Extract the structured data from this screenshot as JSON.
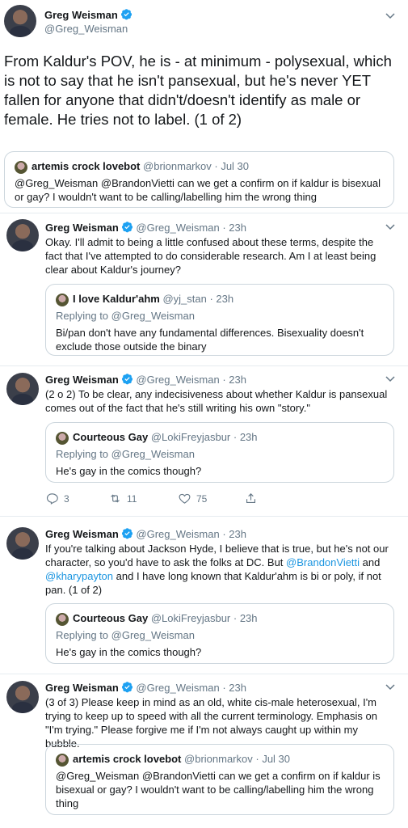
{
  "main": {
    "author": {
      "name": "Greg Weisman",
      "handle": "@Greg_Weisman"
    },
    "text": "From Kaldur's POV, he is - at minimum - polysexual, which is not to say that he isn't pansexual, but he's never YET  fallen for anyone that didn't/doesn't identify as male or female.  He tries not to label.  (1 of 2)",
    "quote": {
      "name": "artemis crock lovebot",
      "handle": "@brionmarkov",
      "date": "· Jul 30",
      "text": "@Greg_Weisman @BrandonVietti can we get a confirm on if kaldur is bisexual or gay? I wouldn't want to be calling/labelling him the wrong thing"
    }
  },
  "reply1": {
    "name": "Greg Weisman",
    "handle": "@Greg_Weisman",
    "time": "· 23h",
    "text": "Okay.  I'll admit to being a little confused about these terms, despite the fact that I've attempted to do considerable research.  Am I at least being clear about Kaldur's journey?",
    "quote": {
      "name": "I love Kaldur'ahm",
      "handle": "@yj_stan",
      "time": "· 23h",
      "replying": "Replying to @Greg_Weisman",
      "text": "Bi/pan don't have any fundamental differences. Bisexuality doesn't exclude those outside the binary"
    }
  },
  "reply2": {
    "name": "Greg Weisman",
    "handle": "@Greg_Weisman",
    "time": "· 23h",
    "text": "(2 o 2) To be clear, any indecisiveness about whether Kaldur is pansexual comes out of the fact that he's still writing his own \"story.\"",
    "quote": {
      "name": "Courteous Gay",
      "handle": "@LokiFreyjasbur",
      "time": "· 23h",
      "replying": "Replying to @Greg_Weisman",
      "text": "He's gay in the comics though?"
    },
    "actions": {
      "replies": "3",
      "retweets": "11",
      "likes": "75"
    }
  },
  "reply3": {
    "name": "Greg Weisman",
    "handle": "@Greg_Weisman",
    "time": "· 23h",
    "text_a": "If you're talking about Jackson Hyde, I believe that is true, but he's not our character, so you'd have to ask the folks at DC.  But ",
    "mention_a": "@BrandonVietti",
    "text_b": " and ",
    "mention_b": "@kharypayton",
    "text_c": " and I have long known that Kaldur'ahm is bi or poly, if not pan. (1 of 2)",
    "quote": {
      "name": "Courteous Gay",
      "handle": "@LokiFreyjasbur",
      "time": "· 23h",
      "replying": "Replying to @Greg_Weisman",
      "text": "He's gay in the comics though?"
    }
  },
  "reply4": {
    "name": "Greg Weisman",
    "handle": "@Greg_Weisman",
    "time": "· 23h",
    "text": "(3 of 3) Please keep in mind as an old, white cis-male heterosexual, I'm trying to keep up to speed with all the current terminology.  Emphasis on \"I'm trying.\"  Please forgive me if I'm not always caught up within my bubble.",
    "quote": {
      "name": "artemis crock lovebot",
      "handle": "@brionmarkov",
      "date": "· Jul 30",
      "text": "@Greg_Weisman @BrandonVietti can we get a confirm on if kaldur is bisexual or gay? I wouldn't want to be calling/labelling him the wrong thing"
    }
  },
  "colors": {
    "link": "#1b95e0",
    "verified": "#1da1f2",
    "muted": "#657786",
    "border": "#ccd6dd"
  }
}
